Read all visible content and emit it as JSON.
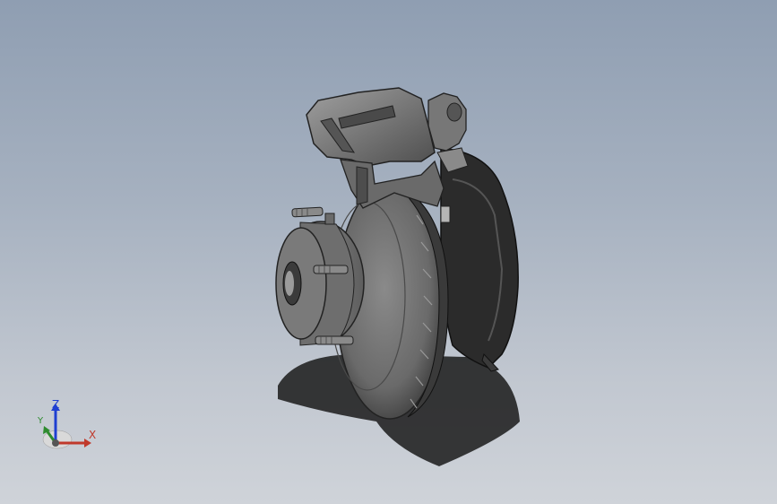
{
  "viewport": {
    "background_top": "#8f9eb2",
    "background_bottom": "#cfd3d9"
  },
  "model": {
    "body_color": "#5a5a5a",
    "dark_color": "#2b2b2b",
    "light_color": "#9a9a9a"
  },
  "triad": {
    "x_label": "X",
    "y_label": "Y",
    "z_label": "Z",
    "x_color": "#c0392b",
    "y_color": "#2e8b2e",
    "z_color": "#1f3fd1"
  }
}
